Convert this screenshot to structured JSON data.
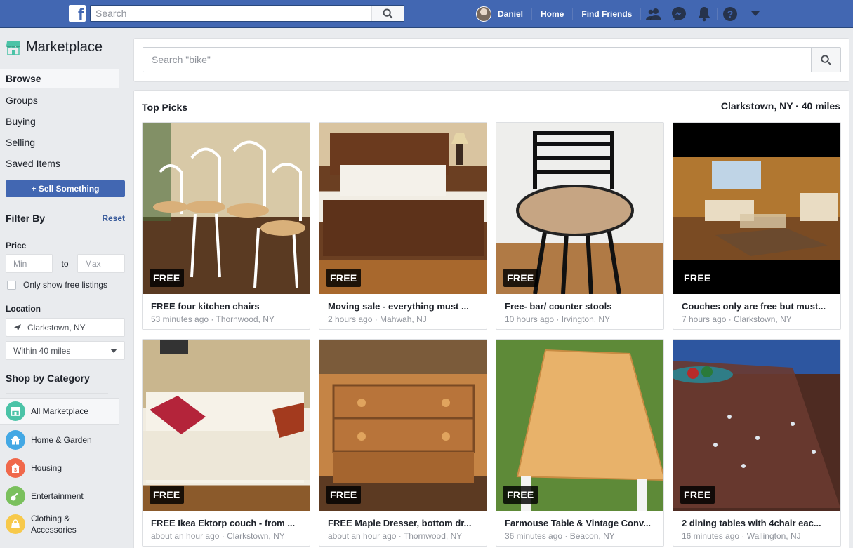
{
  "topbar": {
    "search_placeholder": "Search",
    "user_name": "Daniel",
    "home": "Home",
    "find_friends": "Find Friends"
  },
  "sidebar": {
    "title": "Marketplace",
    "nav": [
      {
        "label": "Browse"
      },
      {
        "label": "Groups"
      },
      {
        "label": "Buying"
      },
      {
        "label": "Selling"
      },
      {
        "label": "Saved Items"
      }
    ],
    "sell_button": "+ Sell Something",
    "filter_title": "Filter By",
    "reset": "Reset",
    "price_label": "Price",
    "price_min_placeholder": "Min",
    "price_to": "to",
    "price_max_placeholder": "Max",
    "free_only": "Only show free listings",
    "location_label": "Location",
    "location_value": "Clarkstown, NY",
    "radius": "Within 40 miles",
    "shop_title": "Shop by Category",
    "categories": [
      {
        "label": "All Marketplace",
        "color": "#4bc3a7"
      },
      {
        "label": "Home & Garden",
        "color": "#43a8e4"
      },
      {
        "label": "Housing",
        "color": "#f0684b"
      },
      {
        "label": "Entertainment",
        "color": "#7ac05d"
      },
      {
        "label": "Clothing &\nAccessories",
        "color": "#f7c94b"
      }
    ]
  },
  "main": {
    "search_placeholder": "Search \"bike\"",
    "top_picks": "Top Picks",
    "location": "Clarkstown, NY · 40 miles",
    "free_badge": "FREE",
    "listings": [
      {
        "title": "FREE four kitchen chairs",
        "meta": "53 minutes ago · Thornwood, NY"
      },
      {
        "title": "Moving sale - everything must ...",
        "meta": "2 hours ago · Mahwah, NJ"
      },
      {
        "title": "Free- bar/ counter stools",
        "meta": "10 hours ago · Irvington, NY"
      },
      {
        "title": "Couches only are free but must...",
        "meta": "7 hours ago · Clarkstown, NY"
      },
      {
        "title": "FREE Ikea Ektorp couch - from ...",
        "meta": "about an hour ago · Clarkstown, NY"
      },
      {
        "title": "FREE Maple Dresser, bottom dr...",
        "meta": "about an hour ago · Thornwood, NY"
      },
      {
        "title": "Farmouse Table & Vintage Conv...",
        "meta": "36 minutes ago · Beacon, NY"
      },
      {
        "title": "2 dining tables with 4chair eac...",
        "meta": "16 minutes ago · Wallington, NJ"
      }
    ]
  }
}
